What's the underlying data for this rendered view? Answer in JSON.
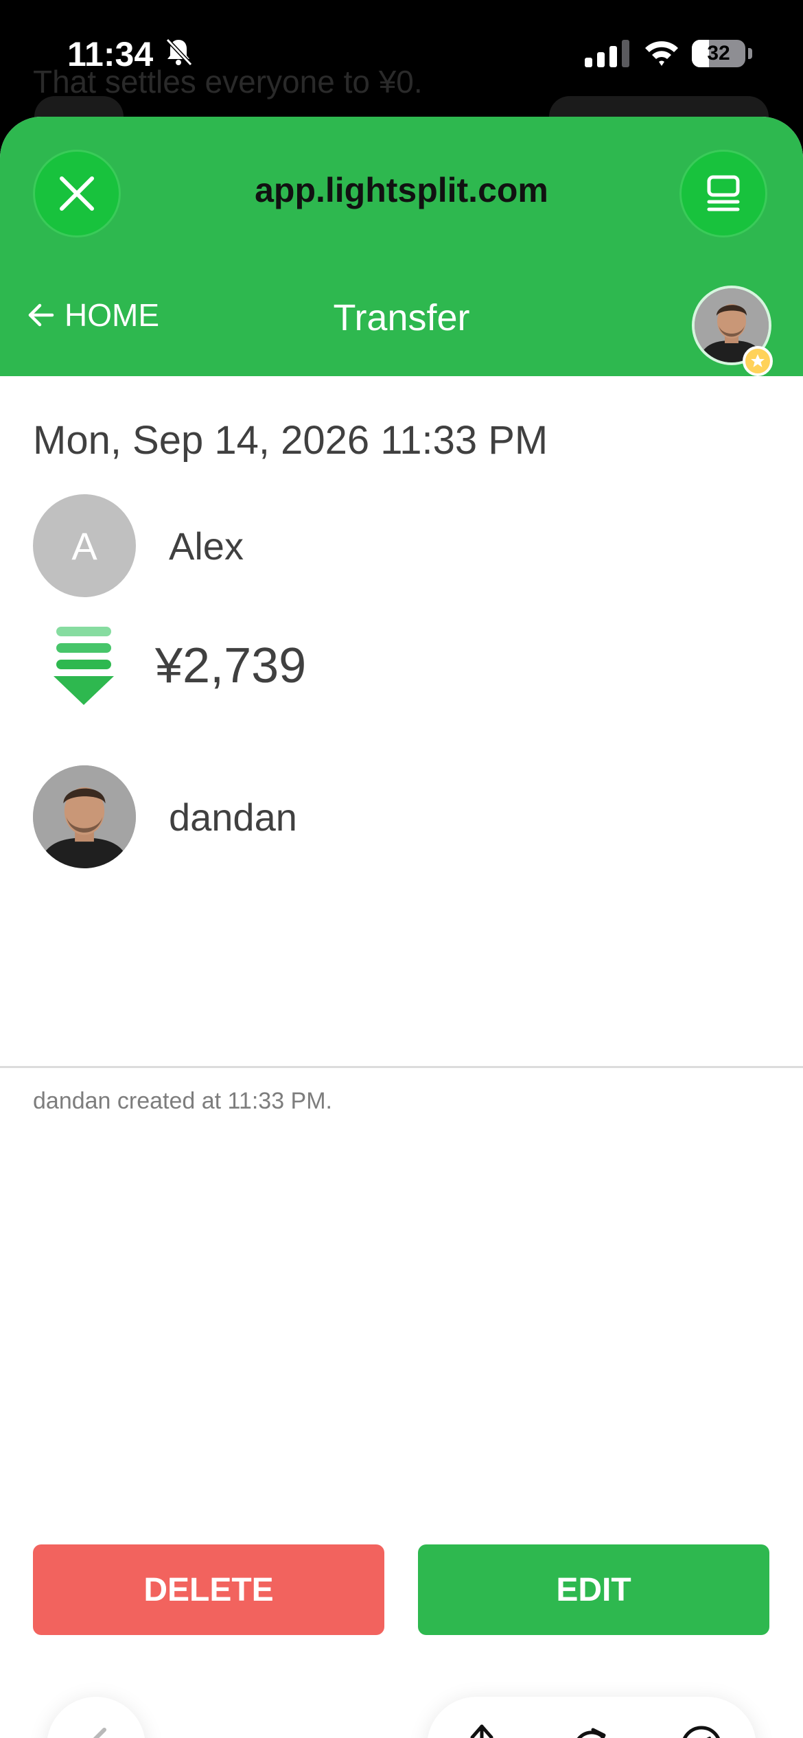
{
  "status_bar": {
    "time": "11:34",
    "battery": "32",
    "battery_level": 0.32,
    "background_text": "That settles everyone to ¥0."
  },
  "browser": {
    "url": "app.lightsplit.com",
    "close_icon": "close-icon",
    "tabs_icon": "tabs-icon"
  },
  "header": {
    "back_label": "HOME",
    "title": "Transfer"
  },
  "transfer": {
    "date": "Mon, Sep 14, 2026 11:33 PM",
    "from": {
      "initial": "A",
      "name": "Alex"
    },
    "amount": "¥2,739",
    "to": {
      "name": "dandan"
    }
  },
  "activity": {
    "created_text": "dandan created at 11:33 PM."
  },
  "actions": {
    "delete_label": "DELETE",
    "edit_label": "EDIT"
  },
  "colors": {
    "brand_green": "#2eb84f",
    "delete_red": "#f2635e",
    "text": "#404040"
  }
}
